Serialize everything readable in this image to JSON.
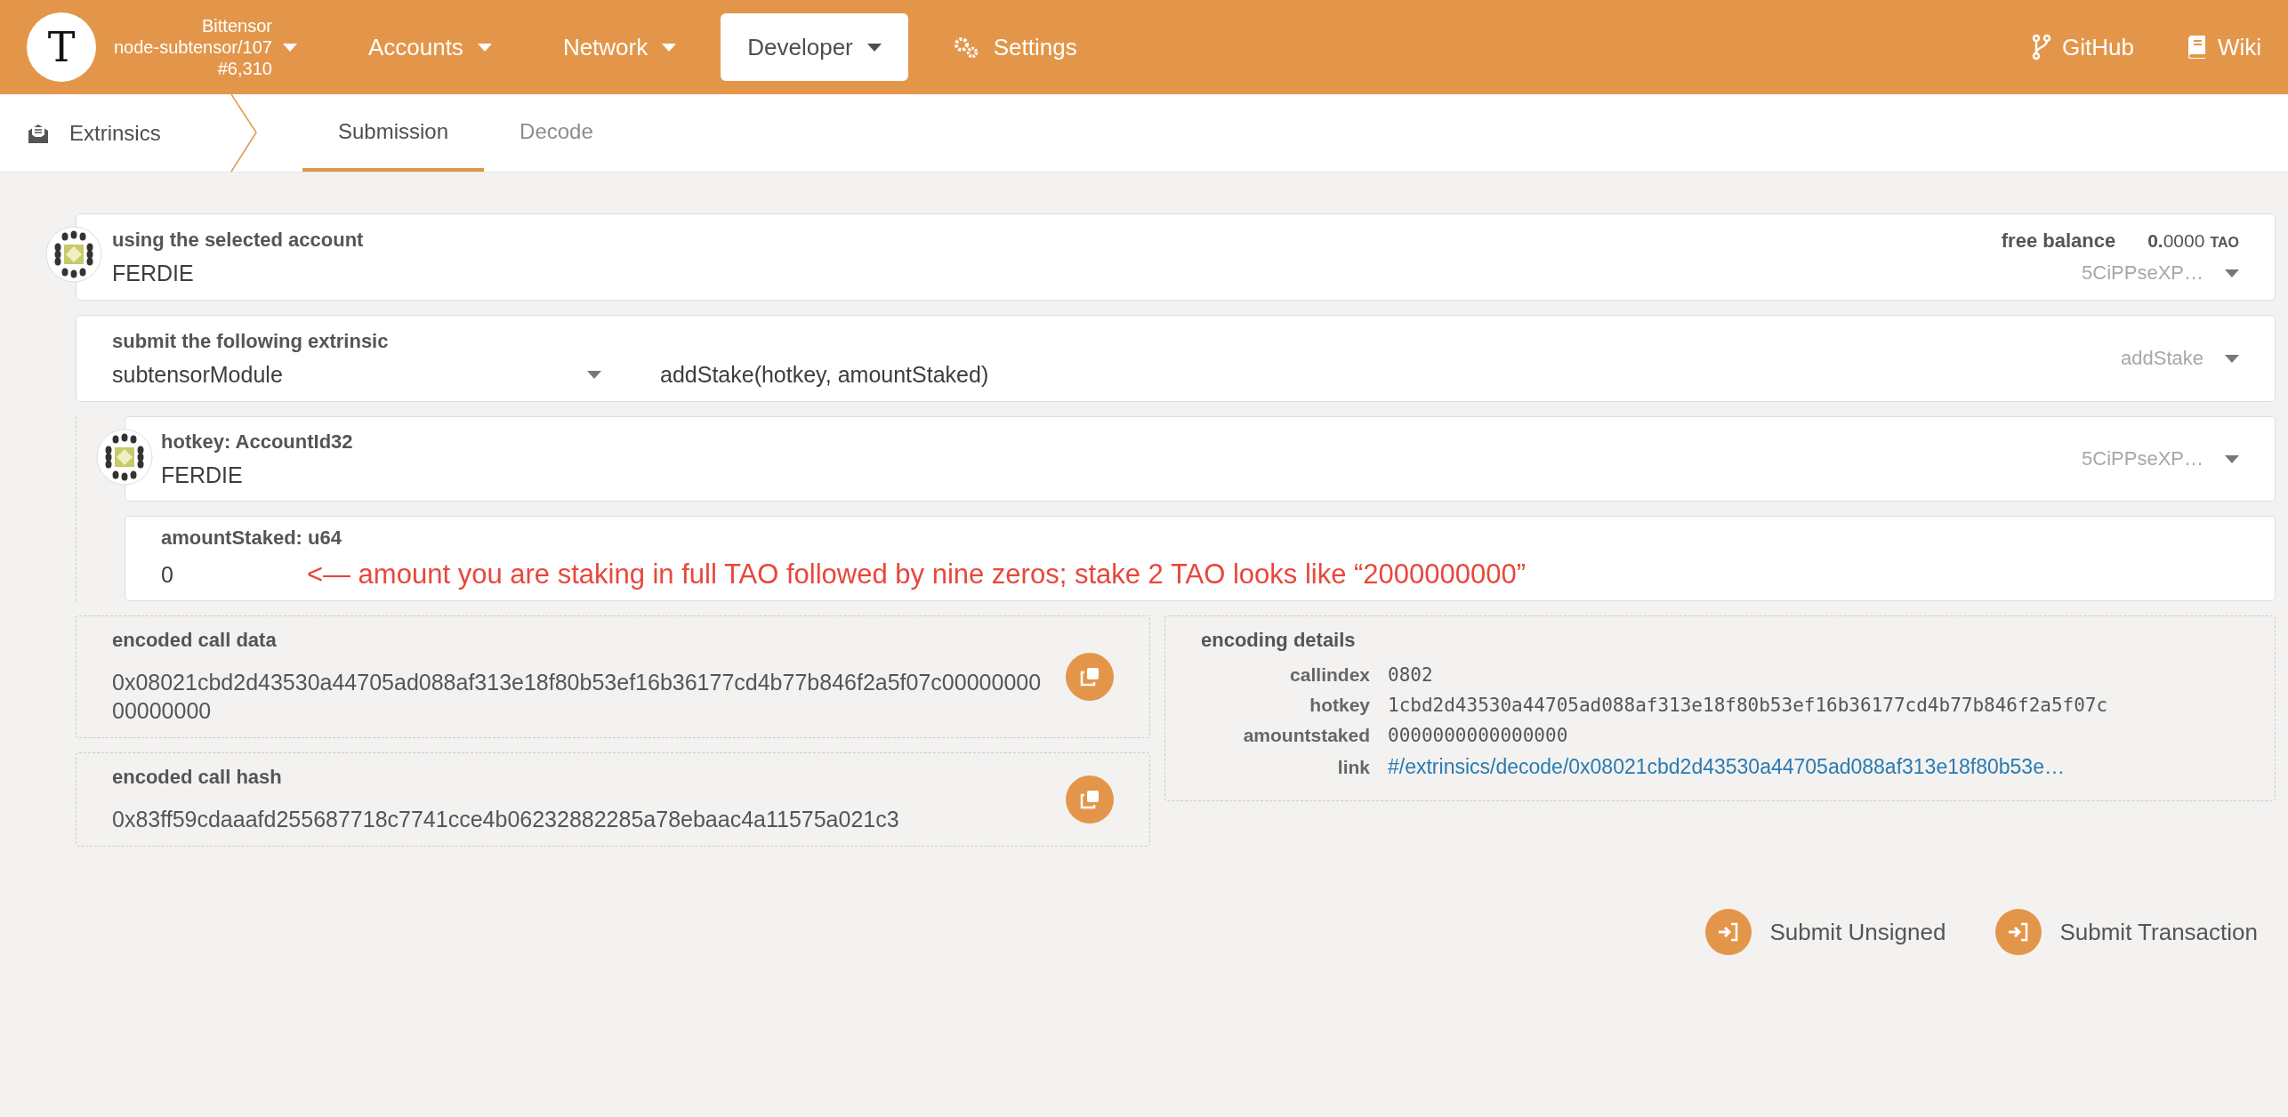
{
  "header": {
    "logo": "T",
    "chain": {
      "name": "Bittensor",
      "node": "node-subtensor/107",
      "block": "#6,310"
    },
    "nav": [
      {
        "label": "Accounts",
        "selected": false,
        "kind": "dropdown"
      },
      {
        "label": "Network",
        "selected": false,
        "kind": "dropdown"
      },
      {
        "label": "Developer",
        "selected": true,
        "kind": "dropdown"
      },
      {
        "label": "Settings",
        "selected": false,
        "kind": "gears"
      }
    ],
    "links": [
      {
        "label": "GitHub",
        "kind": "branch"
      },
      {
        "label": "Wiki",
        "kind": "book"
      }
    ]
  },
  "subnav": {
    "section": "Extrinsics",
    "tabs": [
      {
        "label": "Submission",
        "selected": true
      },
      {
        "label": "Decode",
        "selected": false
      }
    ]
  },
  "account": {
    "label": "using the selected account",
    "value": "FERDIE",
    "balance_label": "free balance",
    "balance_int": "0.",
    "balance_frac": "0000",
    "balance_unit": "TAO",
    "address": "5CiPPseXP…"
  },
  "extrinsic": {
    "label": "submit the following extrinsic",
    "module": "subtensorModule",
    "call": "addStake(hotkey, amountStaked)",
    "call_short": "addStake"
  },
  "params": [
    {
      "kind": "account",
      "label": "hotkey: AccountId32",
      "value": "FERDIE",
      "address": "5CiPPseXP…"
    },
    {
      "kind": "input",
      "label": "amountStaked: u64",
      "value": "0",
      "note": "<— amount you are staking in full TAO followed by nine zeros; stake 2 TAO looks like “2000000000”"
    }
  ],
  "encoded": [
    {
      "label": "encoded call data",
      "value": "0x08021cbd2d43530a44705ad088af313e18f80b53ef16b36177cd4b77b846f2a5f07c0000000000000000"
    },
    {
      "label": "encoded call hash",
      "value": "0x83ff59cdaaafd255687718c7741cce4b06232882285a78ebaac4a11575a021c3"
    }
  ],
  "details": {
    "title": "encoding details",
    "rows": [
      {
        "kind": "code",
        "label": "callindex",
        "value": "0802"
      },
      {
        "kind": "code",
        "label": "hotkey",
        "value": "1cbd2d43530a44705ad088af313e18f80b53ef16b36177cd4b77b846f2a5f07c"
      },
      {
        "kind": "code",
        "label": "amountstaked",
        "value": "0000000000000000"
      },
      {
        "kind": "link",
        "label": "link",
        "value": "#/extrinsics/decode/0x08021cbd2d43530a44705ad088af313e18f80b53e…"
      }
    ]
  },
  "actions": [
    {
      "label": "Submit Unsigned"
    },
    {
      "label": "Submit Transaction"
    }
  ]
}
